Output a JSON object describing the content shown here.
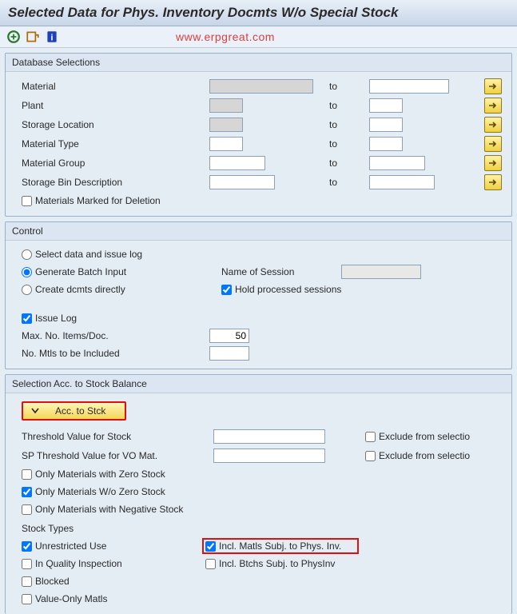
{
  "title": "Selected Data for Phys. Inventory Docmts W/o Special Stock",
  "watermark": "www.erpgreat.com",
  "db": {
    "header": "Database Selections",
    "to_label": "to",
    "rows": [
      {
        "label": "Material"
      },
      {
        "label": "Plant"
      },
      {
        "label": "Storage Location"
      },
      {
        "label": "Material Type"
      },
      {
        "label": "Material Group"
      },
      {
        "label": "Storage Bin Description"
      }
    ],
    "marked_del": "Materials Marked for Deletion"
  },
  "control": {
    "header": "Control",
    "opt_select": "Select data and issue log",
    "opt_batch": "Generate Batch Input",
    "opt_direct": "Create dcmts directly",
    "name_session": "Name of Session",
    "hold_proc": "Hold processed sessions",
    "issue_log": "Issue Log",
    "max_items": "Max. No. Items/Doc.",
    "max_items_val": "50",
    "mtls_included": "No. Mtls to be Included"
  },
  "stock": {
    "header": "Selection Acc. to Stock Balance",
    "toggle": "Acc. to Stck",
    "threshold": "Threshold Value for Stock",
    "sp_threshold": "SP Threshold Value for VO Mat.",
    "exclude": "Exclude from selectio",
    "only_zero": "Only Materials with Zero Stock",
    "only_wo_zero": "Only Materials W/o Zero Stock",
    "only_neg": "Only Materials with Negative Stock",
    "stock_types": "Stock Types",
    "unrestricted": "Unrestricted Use",
    "incl_matls": "Incl. Matls Subj. to Phys. Inv.",
    "in_qi": "In Quality Inspection",
    "incl_btchs": "Incl. Btchs Subj. to PhysInv",
    "blocked": "Blocked",
    "value_only": "Value-Only Matls"
  }
}
